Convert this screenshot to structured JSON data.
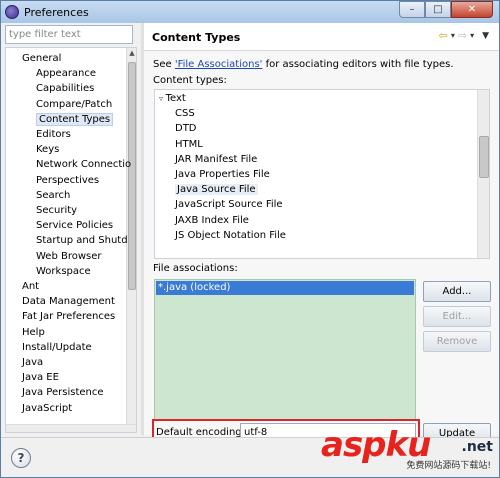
{
  "window": {
    "title": "Preferences",
    "minimize": "–",
    "restore": "□",
    "close": "✕"
  },
  "filter": {
    "placeholder": "type filter text"
  },
  "tree": [
    {
      "label": "General",
      "level": 1
    },
    {
      "label": "Appearance",
      "level": 2
    },
    {
      "label": "Capabilities",
      "level": 2
    },
    {
      "label": "Compare/Patch",
      "level": 2
    },
    {
      "label": "Content Types",
      "level": 2,
      "selected": true
    },
    {
      "label": "Editors",
      "level": 2
    },
    {
      "label": "Keys",
      "level": 2
    },
    {
      "label": "Network Connectio",
      "level": 2
    },
    {
      "label": "Perspectives",
      "level": 2
    },
    {
      "label": "Search",
      "level": 2
    },
    {
      "label": "Security",
      "level": 2
    },
    {
      "label": "Service Policies",
      "level": 2
    },
    {
      "label": "Startup and Shutd",
      "level": 2
    },
    {
      "label": "Web Browser",
      "level": 2
    },
    {
      "label": "Workspace",
      "level": 2
    },
    {
      "label": "Ant",
      "level": 1
    },
    {
      "label": "Data Management",
      "level": 1
    },
    {
      "label": "Fat Jar Preferences",
      "level": 1
    },
    {
      "label": "Help",
      "level": 1
    },
    {
      "label": "Install/Update",
      "level": 1
    },
    {
      "label": "Java",
      "level": 1
    },
    {
      "label": "Java EE",
      "level": 1
    },
    {
      "label": "Java Persistence",
      "level": 1
    },
    {
      "label": "JavaScript",
      "level": 1
    }
  ],
  "page": {
    "title": "Content Types",
    "description_prefix": "See ",
    "description_link": "'File Associations'",
    "description_suffix": " for associating editors with file types.",
    "content_types_label": "Content types:",
    "file_assoc_label": "File associations:",
    "encoding_label": "Default encoding:",
    "encoding_value": "utf-8"
  },
  "content_types": [
    {
      "label": "Text",
      "level": 1
    },
    {
      "label": "CSS",
      "level": 2
    },
    {
      "label": "DTD",
      "level": 2
    },
    {
      "label": "HTML",
      "level": 2
    },
    {
      "label": "JAR Manifest File",
      "level": 2
    },
    {
      "label": "Java Properties File",
      "level": 2
    },
    {
      "label": "Java Source File",
      "level": 2,
      "selected": true
    },
    {
      "label": "JavaScript Source File",
      "level": 2
    },
    {
      "label": "JAXB Index File",
      "level": 2
    },
    {
      "label": "JS Object Notation File",
      "level": 2
    }
  ],
  "file_associations": [
    "*.java (locked)"
  ],
  "buttons": {
    "add": "Add...",
    "edit": "Edit...",
    "remove": "Remove",
    "update": "Update"
  },
  "watermark": {
    "main": "aspku",
    "net": ".net",
    "sub": "免费网站源码下载站!"
  },
  "icons": {
    "help": "?",
    "back": "⇦",
    "forward": "⇨",
    "dropdown": "▾",
    "menu": "▼"
  },
  "colors": {
    "selection": "#3a7bd5",
    "list_bg": "#cde6cf",
    "highlight_border": "#d9262a",
    "link": "#1c49b0"
  }
}
